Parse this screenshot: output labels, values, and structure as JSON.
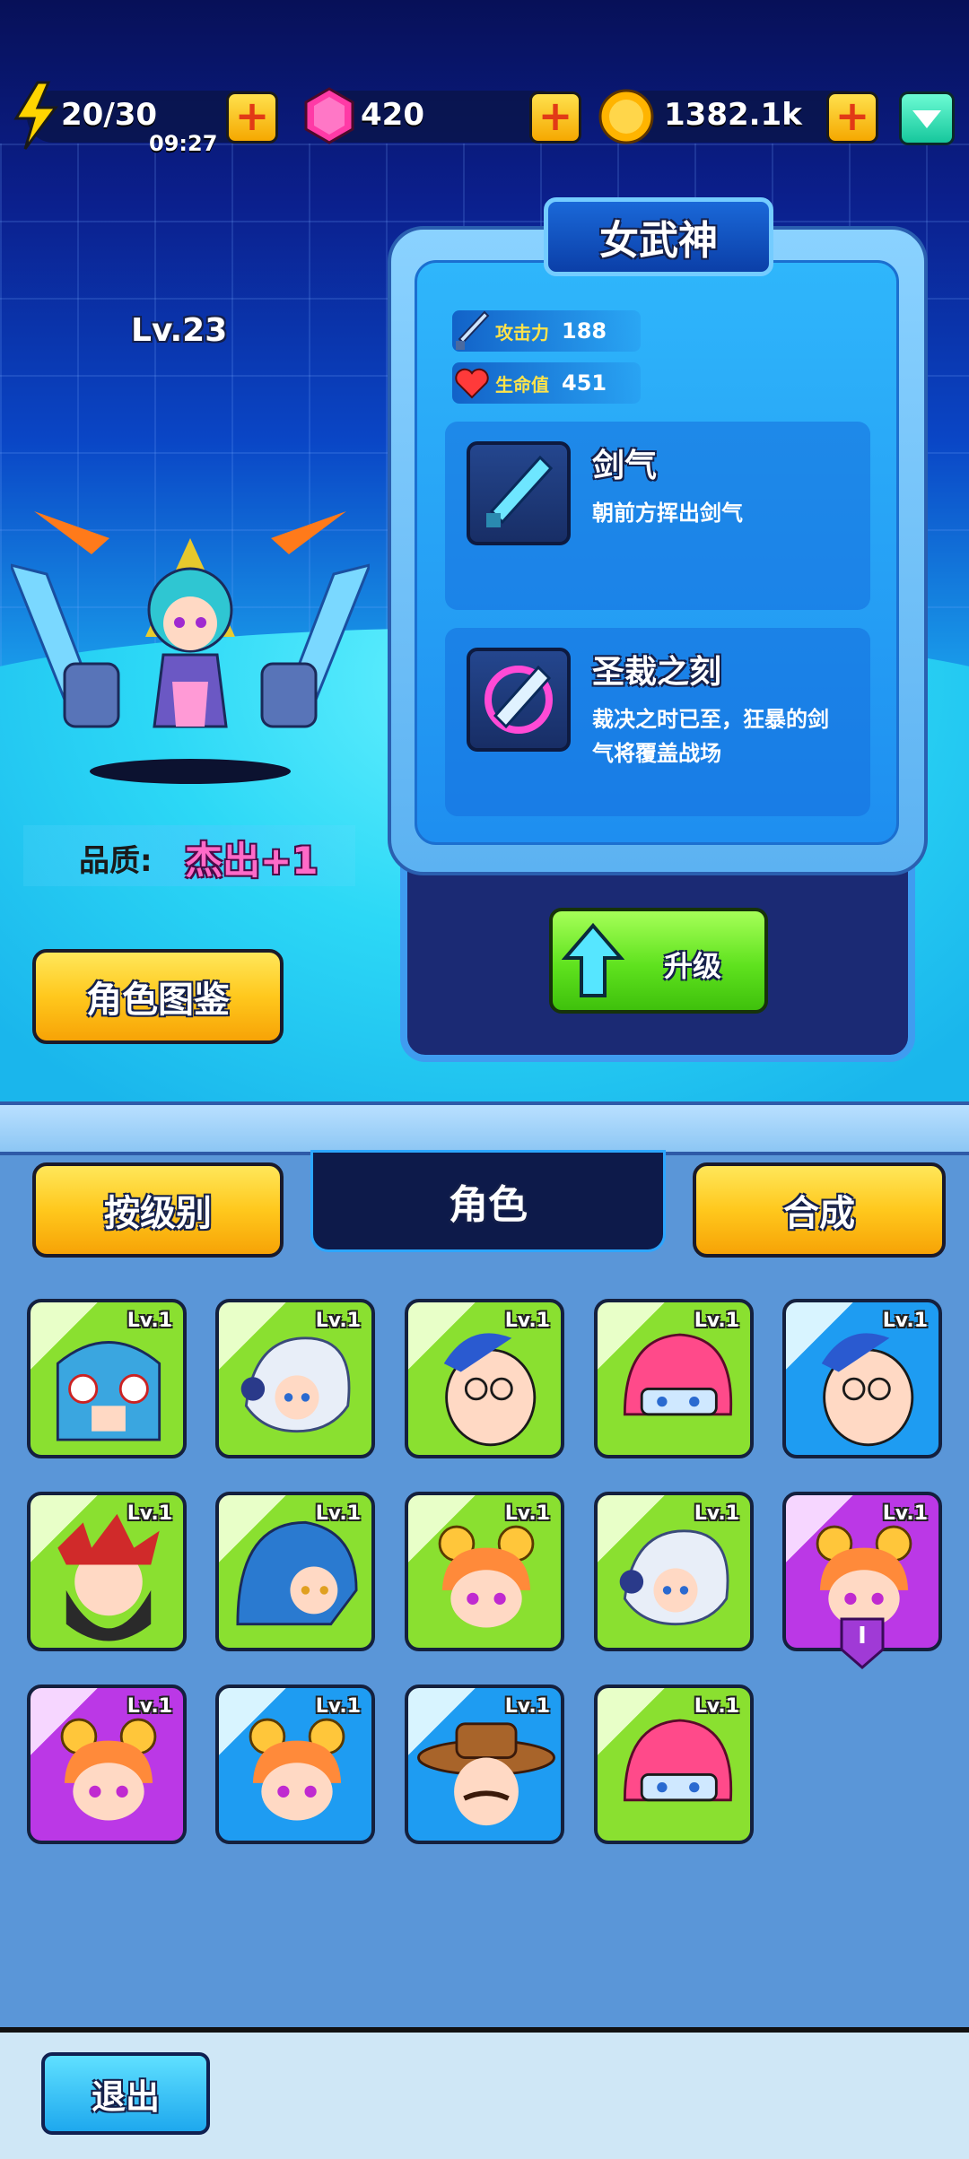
{
  "top_bar": {
    "energy": "20/30",
    "energy_timer": "09:27",
    "gems": "420",
    "coins": "1382.1k"
  },
  "hero": {
    "level": "Lv.23",
    "quality_label": "品质:",
    "quality_value": "杰出+1",
    "name": "女武神",
    "attack_label": "攻击力",
    "attack_value": "188",
    "hp_label": "生命值",
    "hp_value": "451",
    "skills": [
      {
        "name": "剑气",
        "desc": "朝前方挥出剑气"
      },
      {
        "name": "圣裁之刻",
        "desc_line1": "裁决之时已至，狂暴的剑",
        "desc_line2": "气将覆盖战场"
      }
    ],
    "upgrade_label": "升级",
    "codex_label": "角色图鉴"
  },
  "tabs": {
    "by_level": "按级别",
    "role": "角色",
    "combine": "合成"
  },
  "roster": [
    {
      "level": "Lv.1",
      "bg": "green",
      "face": "blue-cat"
    },
    {
      "level": "Lv.1",
      "bg": "green",
      "face": "white-hair"
    },
    {
      "level": "Lv.1",
      "bg": "green",
      "face": "glasses-man"
    },
    {
      "level": "Lv.1",
      "bg": "green",
      "face": "pink-hair"
    },
    {
      "level": "Lv.1",
      "bg": "blue",
      "face": "glasses-man"
    },
    {
      "level": "Lv.1",
      "bg": "green",
      "face": "bearded-man"
    },
    {
      "level": "Lv.1",
      "bg": "green",
      "face": "blue-hood"
    },
    {
      "level": "Lv.1",
      "bg": "green",
      "face": "bun-girl"
    },
    {
      "level": "Lv.1",
      "bg": "green",
      "face": "white-hair"
    },
    {
      "level": "Lv.1",
      "bg": "purple",
      "face": "bun-girl",
      "rank_badge": "I"
    },
    {
      "level": "Lv.1",
      "bg": "purple",
      "face": "bun-girl"
    },
    {
      "level": "Lv.1",
      "bg": "blue",
      "face": "bun-girl"
    },
    {
      "level": "Lv.1",
      "bg": "blue",
      "face": "cowboy"
    },
    {
      "level": "Lv.1",
      "bg": "green",
      "face": "pink-hair"
    }
  ],
  "footer": {
    "exit_label": "退出"
  }
}
